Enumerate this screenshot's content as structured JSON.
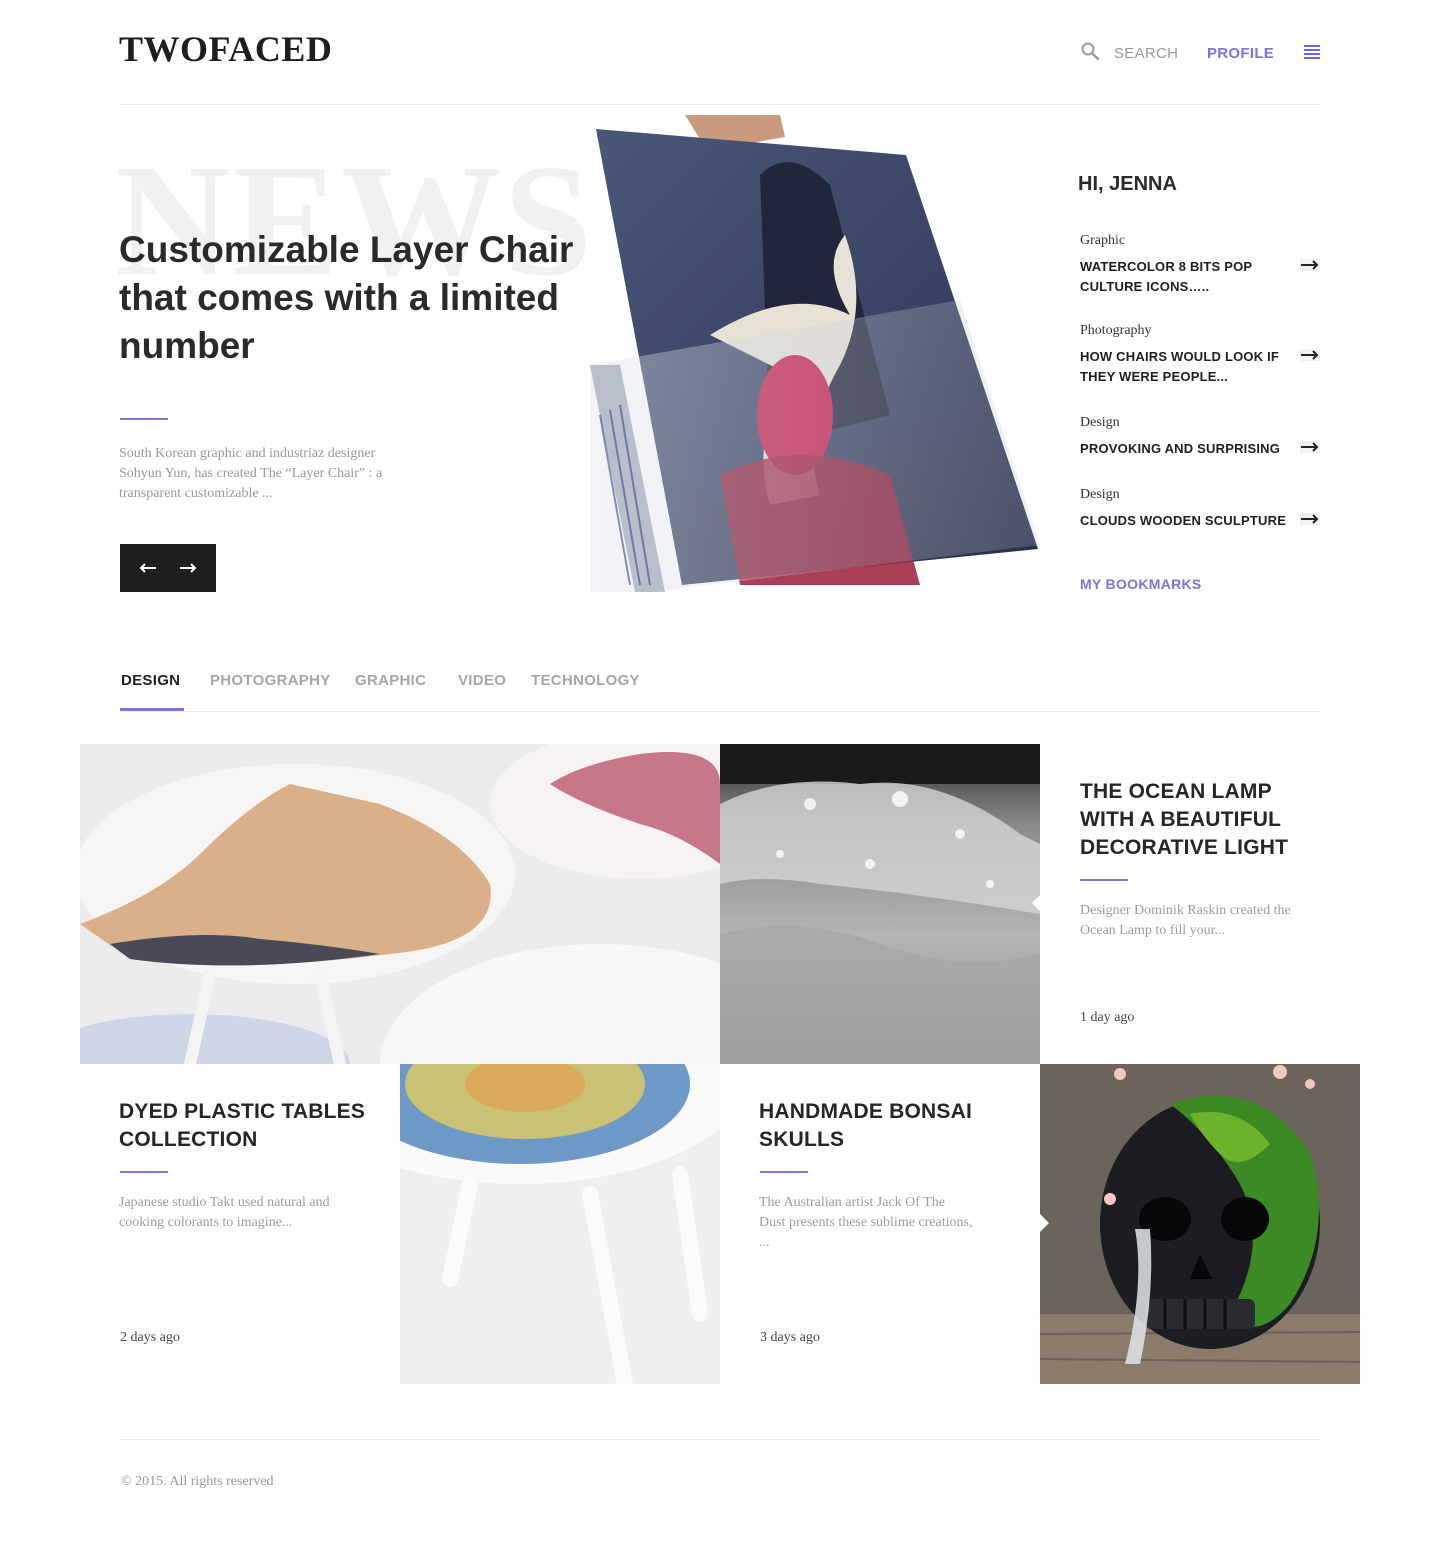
{
  "header": {
    "logo": "TWOFACED",
    "search_label": "SEARCH",
    "profile_label": "PROFILE"
  },
  "hero": {
    "background_word": "NEWS",
    "title": "Customizable Layer Chair that comes with a limited number",
    "excerpt": "South Korean graphic and industriaz designer Sohyun Yun, has created The “Layer Chair” : a transparent customizable ..."
  },
  "sidebar": {
    "greeting": "HI, JENNA",
    "items": [
      {
        "category": "Graphic",
        "title": "WATERCOLOR 8 BITS POP CULTURE ICONS….."
      },
      {
        "category": "Photography",
        "title": "HOW CHAIRS WOULD LOOK IF THEY WERE PEOPLE..."
      },
      {
        "category": "Design",
        "title": "PROVOKING AND SURPRISING"
      },
      {
        "category": "Design",
        "title": "CLOUDS WOODEN SCULPTURE"
      }
    ],
    "bookmarks_label": "MY BOOKMARKS"
  },
  "tabs": [
    {
      "label": "DESIGN",
      "active": true
    },
    {
      "label": "PHOTOGRAPHY",
      "active": false
    },
    {
      "label": "GRAPHIC",
      "active": false
    },
    {
      "label": "VIDEO",
      "active": false
    },
    {
      "label": "TECHNOLOGY",
      "active": false
    }
  ],
  "cards": {
    "ocean_lamp": {
      "title": "THE OCEAN LAMP WITH A BEAUTIFUL DECORATIVE LIGHT",
      "excerpt": "Designer Dominik Raskin created the Ocean Lamp to fill your...",
      "time": "1 day ago"
    },
    "dyed_tables": {
      "title": "DYED PLASTIC TABLES COLLECTION",
      "excerpt": "Japanese studio Takt used natural and cooking colorants to imagine...",
      "time": "2 days ago"
    },
    "bonsai_skulls": {
      "title": "HANDMADE BONSAI SKULLS",
      "excerpt": "The Australian artist Jack Of The Dust presents these sublime creations, ...",
      "time": "3 days ago"
    }
  },
  "footer": {
    "copyright": "© 2015. All rights reserved"
  },
  "colors": {
    "accent": "#7b73e0",
    "dark": "#1f1f1f",
    "muted": "#999999"
  },
  "icons": [
    "search-icon",
    "menu-icon",
    "arrow-left-icon",
    "arrow-right-icon"
  ]
}
